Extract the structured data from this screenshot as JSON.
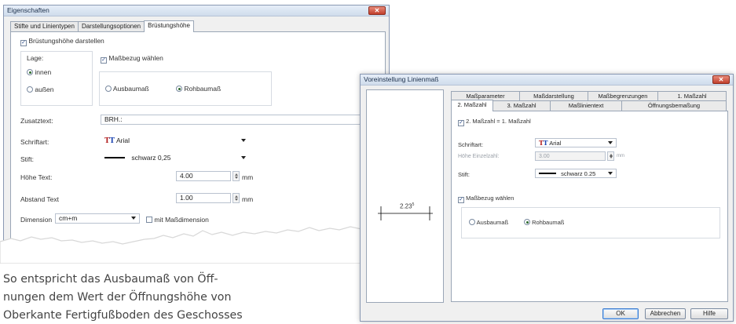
{
  "dialog1": {
    "title": "Eigenschaften",
    "close_glyph": "✕",
    "tabs": [
      "Stifte und Linientypen",
      "Darstellungsoptionen",
      "Brüstungshöhe"
    ],
    "show_parapet": "Brüstungshöhe darstellen",
    "position_label": "Lage:",
    "position_inside": "innen",
    "position_outside": "außen",
    "dim_ref": "Maßbezug wählen",
    "finish_dim": "Ausbaumaß",
    "rough_dim": "Rohbaumaß",
    "extra_text_label": "Zusatztext:",
    "extra_text_value": "BRH.:",
    "font_label": "Schriftart:",
    "font_value": "Arial",
    "pen_label": "Stift:",
    "pen_value": "schwarz 0,25",
    "text_height_label": "Höhe Text:",
    "text_height_value": "4.00",
    "text_height_unit": "mm",
    "text_spacing_label": "Abstand Text",
    "text_spacing_value": "1.00",
    "text_spacing_unit": "mm",
    "dimension_label": "Dimension",
    "dimension_value": "cm+m",
    "with_dimension": "mit Maßdimension"
  },
  "dialog2": {
    "title": "Voreinstellung Linienmaß",
    "close_glyph": "✕",
    "preview_value": "2.23",
    "preview_sup": "5",
    "tabs_row1": [
      "Maßparameter",
      "Maßdarstellung",
      "Maßbegrenzungen",
      "1. Maßzahl"
    ],
    "tabs_row2": [
      "2. Maßzahl",
      "3. Maßzahl",
      "Maßlinientext",
      "Öffnungsbemaßung"
    ],
    "second_eq_first": "2. Maßzahl = 1. Maßzahl",
    "font_label": "Schriftart:",
    "font_value": "Arial",
    "height_label": "Höhe Einzelzahl:",
    "height_value": "3.00",
    "height_unit": "mm",
    "pen_label": "Stift:",
    "pen_value": "schwarz 0.25",
    "dim_ref": "Maßbezug wählen",
    "finish_dim": "Ausbaumaß",
    "rough_dim": "Rohbaumaß",
    "ok": "OK",
    "cancel": "Abbrechen",
    "help": "Hilfe"
  },
  "caption": {
    "line1": "So entspricht das Ausbaumaß von Öff-",
    "line2": "nungen dem Wert der Öffnungshöhe von",
    "line3": "Oberkante Fertigfußboden des Geschosses"
  }
}
